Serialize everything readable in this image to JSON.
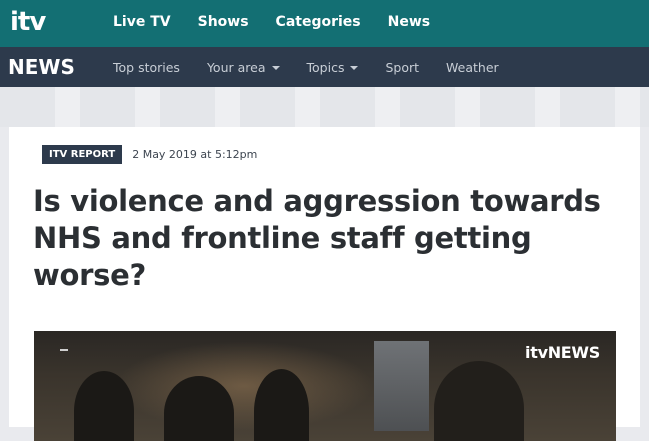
{
  "header": {
    "logo_text": "itv",
    "nav": [
      "Live TV",
      "Shows",
      "Categories",
      "News"
    ]
  },
  "news_bar": {
    "title": "NEWS",
    "items": [
      {
        "label": "Top stories",
        "dropdown": false
      },
      {
        "label": "Your area",
        "dropdown": true
      },
      {
        "label": "Topics",
        "dropdown": true
      },
      {
        "label": "Sport",
        "dropdown": false
      },
      {
        "label": "Weather",
        "dropdown": false
      }
    ]
  },
  "article": {
    "badge": "ITV REPORT",
    "date": "2 May 2019 at 5:12pm",
    "headline": "Is violence and aggression towards NHS and frontline staff getting worse?"
  },
  "video": {
    "watermark": "itvNEWS"
  },
  "colors": {
    "top_bar": "#136f73",
    "news_bar": "#2d3a4c",
    "badge": "#2d3a4c",
    "headline": "#2b2f33"
  }
}
